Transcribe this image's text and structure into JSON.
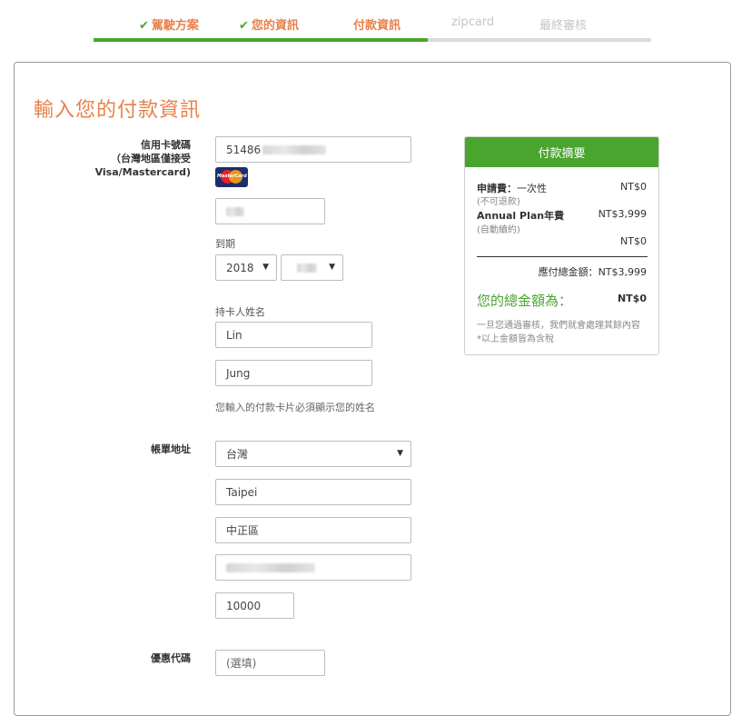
{
  "steps": [
    {
      "label": "駕駛方案",
      "state": "done"
    },
    {
      "label": "您的資訊",
      "state": "done"
    },
    {
      "label": "付款資訊",
      "state": "current"
    },
    {
      "label": "zipcard",
      "state": "todo"
    },
    {
      "label": "最終審核",
      "state": "todo"
    }
  ],
  "check_glyph": "✔",
  "page_title": "輸入您的付款資訊",
  "card": {
    "label_line1": "信用卡號碼",
    "label_line2": "（台灣地區僅接受",
    "label_line3": "Visa/Mastercard)",
    "number_value": "51486",
    "brand_icon": "mastercard-icon",
    "brand_text": "MasterCard",
    "expiry_label": "到期",
    "expiry_year": "2018",
    "holder_label": "持卡人姓名",
    "first_name": "Lin",
    "last_name": "Jung",
    "holder_hint": "您輸入的付款卡片必須顯示您的姓名"
  },
  "billing": {
    "label": "帳單地址",
    "country": "台灣",
    "city": "Taipei",
    "district": "中正區",
    "postal": "10000"
  },
  "promo": {
    "label": "優惠代碼",
    "placeholder": "(選填)"
  },
  "summary": {
    "title": "付款摘要",
    "fee_label": "申請費：",
    "fee_type": "一次性",
    "fee_note": "(不可退款)",
    "fee_value": "NT$0",
    "plan_label": "Annual Plan年費",
    "plan_note": "(自動續約)",
    "plan_value": "NT$3,999",
    "discount_value": "NT$0",
    "payable_label": "應付總金額：",
    "payable_value": "NT$3,999",
    "total_label": "您的總金額為：",
    "total_value": "NT$0",
    "note1": "一旦您通過審核，我們就會處理其餘內容",
    "note2": "*以上金額皆為含稅"
  },
  "colors": {
    "accent_orange": "#e8804a",
    "accent_green": "#4aa52e"
  },
  "progress_fraction": 0.6
}
